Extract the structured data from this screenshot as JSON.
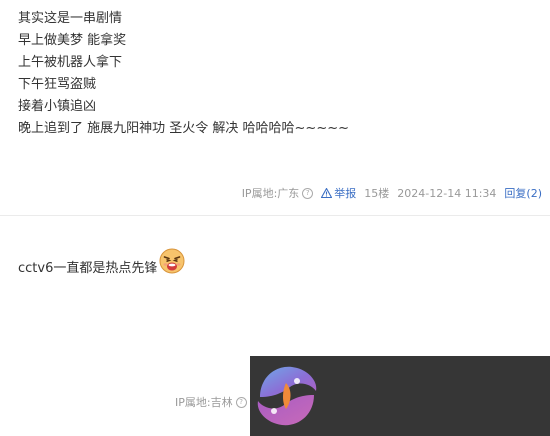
{
  "post1": {
    "lines": [
      "其实这是一串剧情",
      "早上做美梦 能拿奖",
      "上午被机器人拿下",
      "下午狂骂盗贼",
      "接着小镇追凶",
      "晚上追到了 施展九阳神功 圣火令 解决 哈哈哈哈~~~~~"
    ],
    "meta": {
      "ip": "IP属地:广东",
      "report": "举报",
      "floor": "15楼",
      "time": "2024-12-14 11:34",
      "reply": "回复(2)"
    }
  },
  "post2": {
    "text": "cctv6一直都是热点先锋",
    "emoji_icon": "grinning-face-emoji",
    "meta": {
      "ip": "IP属地:吉林"
    }
  },
  "overlay": {
    "icon": "app-logo-icon",
    "background": "#363636"
  },
  "colors": {
    "text": "#333333",
    "meta": "#999999",
    "link": "#3a6ec4",
    "divider": "#ebebeb"
  }
}
